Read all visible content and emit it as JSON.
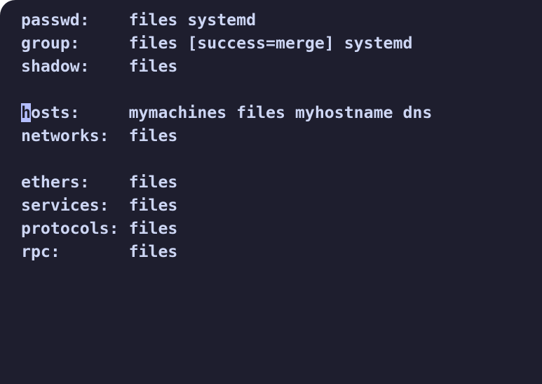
{
  "editor": {
    "cursor": {
      "line": 4,
      "col": 0
    },
    "lines": [
      {
        "key": "passwd:",
        "value": "files systemd"
      },
      {
        "key": "group:",
        "value": "files [success=merge] systemd"
      },
      {
        "key": "shadow:",
        "value": "files"
      },
      {
        "key": "",
        "value": ""
      },
      {
        "key": "hosts:",
        "value": "mymachines files myhostname dns"
      },
      {
        "key": "networks:",
        "value": "files"
      },
      {
        "key": "",
        "value": ""
      },
      {
        "key": "ethers:",
        "value": "files"
      },
      {
        "key": "services:",
        "value": "files"
      },
      {
        "key": "protocols:",
        "value": "files"
      },
      {
        "key": "rpc:",
        "value": "files"
      }
    ]
  },
  "colors": {
    "background": "#1e1e2e",
    "foreground": "#cdd6f4",
    "cursor": "#b4befe"
  }
}
